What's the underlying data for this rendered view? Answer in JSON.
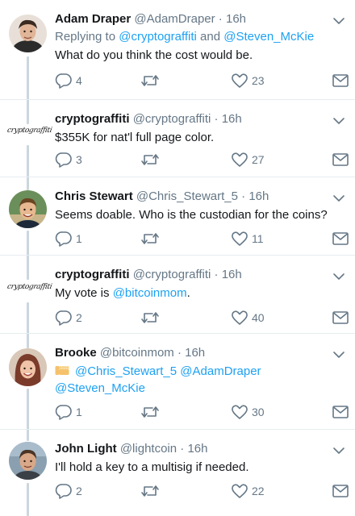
{
  "tweets": [
    {
      "name": "Adam Draper",
      "handle": "@AdamDraper",
      "time": "16h",
      "replying_prefix": "Replying to ",
      "replying_mention1": "@cryptograffiti",
      "replying_and": " and ",
      "replying_mention2": "@Steven_McKie",
      "text": "What do you think the cost would be.",
      "replies": "4",
      "retweets": "",
      "likes": "23",
      "avatar_icon": "adam-draper-avatar"
    },
    {
      "name": "cryptograffiti",
      "handle": "@cryptograffiti",
      "time": "16h",
      "logo_text": "cryptograffiti",
      "text": "$355K for nat'l full page color.",
      "replies": "3",
      "retweets": "",
      "likes": "27",
      "avatar_icon": "cryptograffiti-logo"
    },
    {
      "name": "Chris Stewart",
      "handle": "@Chris_Stewart_5",
      "time": "16h",
      "text": "Seems doable. Who is the custodian for the coins?",
      "replies": "1",
      "retweets": "",
      "likes": "11",
      "avatar_icon": "chris-stewart-avatar"
    },
    {
      "name": "cryptograffiti",
      "handle": "@cryptograffiti",
      "time": "16h",
      "logo_text": "cryptograffiti",
      "text_prefix": "My vote is ",
      "text_mention": "@bitcoinmom",
      "text_suffix": ".",
      "replies": "2",
      "retweets": "",
      "likes": "40",
      "avatar_icon": "cryptograffiti-logo"
    },
    {
      "name": "Brooke",
      "handle": "@bitcoinmom",
      "time": "16h",
      "mention1": "@Chris_Stewart_5",
      "mention2": "@AdamDraper",
      "mention3": "@Steven_McKie",
      "emoji_icon": "fist-bump-emoji",
      "replies": "1",
      "retweets": "",
      "likes": "30",
      "avatar_icon": "brooke-avatar"
    },
    {
      "name": "John Light",
      "handle": "@lightcoin",
      "time": "16h",
      "text": "I'll hold a key to a multisig if needed.",
      "replies": "2",
      "retweets": "",
      "likes": "22",
      "avatar_icon": "john-light-avatar"
    }
  ],
  "separator": " · ",
  "colors": {
    "link": "#1da1f2",
    "secondary_text": "#657786",
    "primary_text": "#14171a",
    "thread_line": "#ccd6dd",
    "divider": "#e6ecf0"
  }
}
